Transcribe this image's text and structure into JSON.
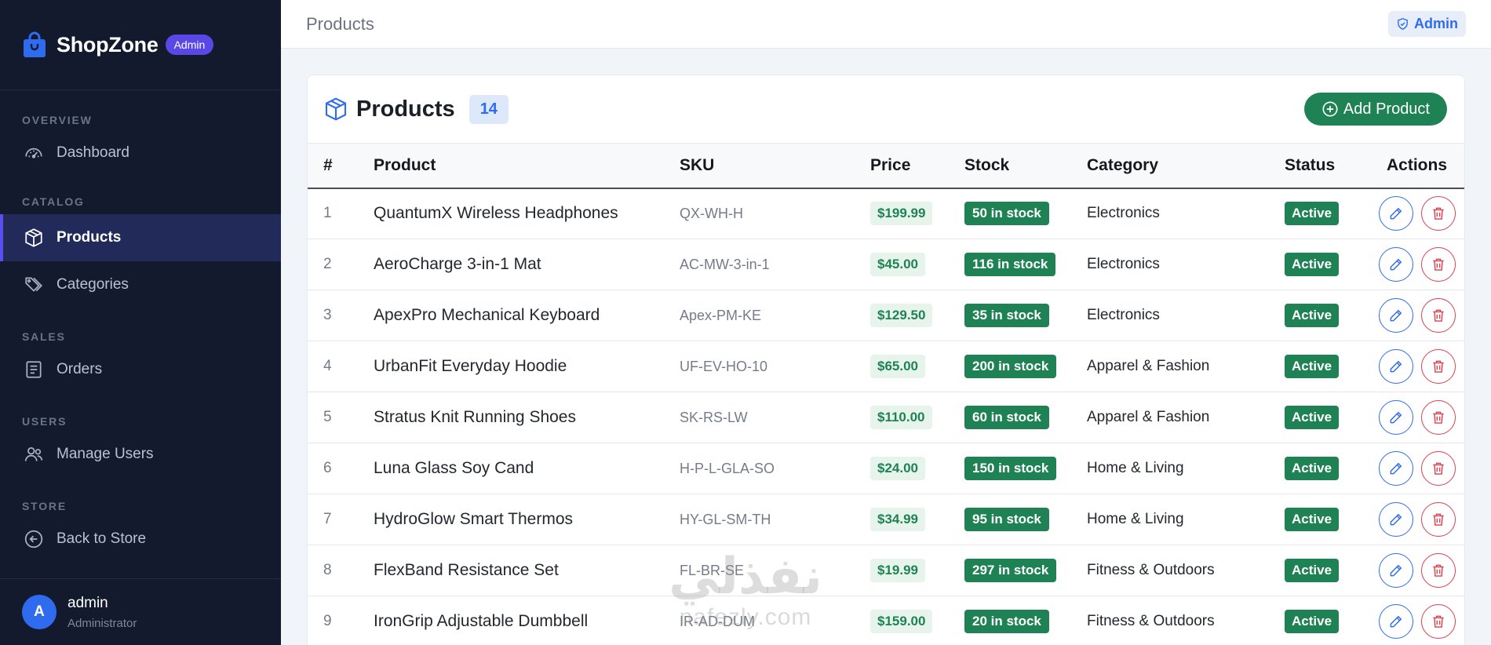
{
  "brand": {
    "name": "ShopZone",
    "badge": "Admin"
  },
  "sidebar": {
    "sections": [
      {
        "label": "OVERVIEW",
        "items": [
          {
            "label": "Dashboard",
            "icon": "gauge-icon"
          }
        ]
      },
      {
        "label": "CATALOG",
        "items": [
          {
            "label": "Products",
            "icon": "box-icon",
            "active": true
          },
          {
            "label": "Categories",
            "icon": "tags-icon"
          }
        ]
      },
      {
        "label": "SALES",
        "items": [
          {
            "label": "Orders",
            "icon": "receipt-icon"
          }
        ]
      },
      {
        "label": "USERS",
        "items": [
          {
            "label": "Manage Users",
            "icon": "people-icon"
          }
        ]
      },
      {
        "label": "STORE",
        "items": [
          {
            "label": "Back to Store",
            "icon": "arrow-left-circle-icon"
          }
        ]
      }
    ],
    "user": {
      "initial": "A",
      "name": "admin",
      "role": "Administrator"
    }
  },
  "topbar": {
    "title": "Products",
    "admin_label": "Admin"
  },
  "card": {
    "title": "Products",
    "count": "14",
    "add_label": "Add Product"
  },
  "table": {
    "headers": {
      "num": "#",
      "product": "Product",
      "sku": "SKU",
      "price": "Price",
      "stock": "Stock",
      "category": "Category",
      "status": "Status",
      "actions": "Actions"
    },
    "rows": [
      {
        "num": "1",
        "product": "QuantumX Wireless Headphones",
        "sku": "QX-WH-H",
        "price": "$199.99",
        "stock": "50 in stock",
        "category": "Electronics",
        "status": "Active"
      },
      {
        "num": "2",
        "product": "AeroCharge 3-in-1 Mat",
        "sku": "AC-MW-3-in-1",
        "price": "$45.00",
        "stock": "116 in stock",
        "category": "Electronics",
        "status": "Active"
      },
      {
        "num": "3",
        "product": "ApexPro Mechanical Keyboard",
        "sku": "Apex-PM-KE",
        "price": "$129.50",
        "stock": "35 in stock",
        "category": "Electronics",
        "status": "Active"
      },
      {
        "num": "4",
        "product": "UrbanFit Everyday Hoodie",
        "sku": "UF-EV-HO-10",
        "price": "$65.00",
        "stock": "200 in stock",
        "category": "Apparel & Fashion",
        "status": "Active"
      },
      {
        "num": "5",
        "product": "Stratus Knit Running Shoes",
        "sku": "SK-RS-LW",
        "price": "$110.00",
        "stock": "60 in stock",
        "category": "Apparel & Fashion",
        "status": "Active"
      },
      {
        "num": "6",
        "product": "Luna Glass Soy Cand",
        "sku": "H-P-L-GLA-SO",
        "price": "$24.00",
        "stock": "150 in stock",
        "category": "Home & Living",
        "status": "Active"
      },
      {
        "num": "7",
        "product": "HydroGlow Smart Thermos",
        "sku": "HY-GL-SM-TH",
        "price": "$34.99",
        "stock": "95 in stock",
        "category": "Home & Living",
        "status": "Active"
      },
      {
        "num": "8",
        "product": "FlexBand Resistance Set",
        "sku": "FL-BR-SE",
        "price": "$19.99",
        "stock": "297 in stock",
        "category": "Fitness & Outdoors",
        "status": "Active"
      },
      {
        "num": "9",
        "product": "IronGrip Adjustable Dumbbell",
        "sku": "IR-AD-DUM",
        "price": "$159.00",
        "stock": "20 in stock",
        "category": "Fitness & Outdoors",
        "status": "Active"
      }
    ]
  },
  "watermark": {
    "arabic": "نفذلي",
    "latin": "nafezly.com"
  },
  "colors": {
    "sidebar_bg": "#131a2e",
    "accent": "#5a48e6",
    "primary": "#2f6bef",
    "success": "#1f8254",
    "danger": "#dc3f4e"
  }
}
